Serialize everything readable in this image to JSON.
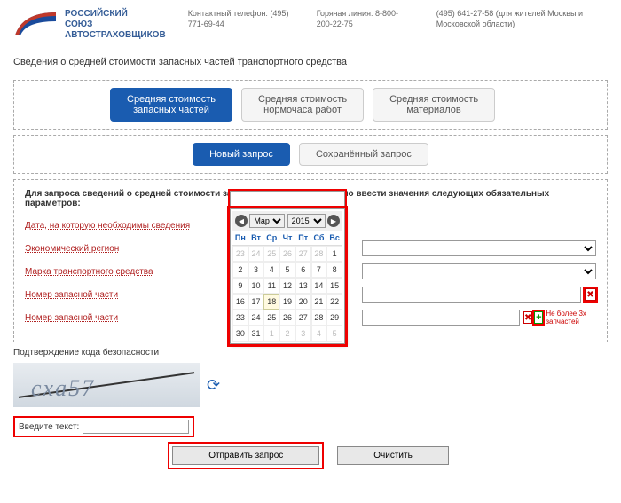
{
  "header": {
    "org_line1": "РОССИЙСКИЙ",
    "org_line2": "СОЮЗ",
    "org_line3": "АВТОСТРАХОВЩИКОВ",
    "contact1_label": "Контактный телефон: (495) 771-69-44",
    "contact2_label": "Горячая линия: 8-800-200-22-75",
    "contact3_label": "(495) 641-27-58 (для жителей Москвы и Московской области)"
  },
  "page_title": "Сведения о средней стоимости запасных частей транспортного средства",
  "tabs_main": {
    "parts": "Средняя стоимость\nзапасных частей",
    "hours": "Средняя стоимость\nнормочаса работ",
    "materials": "Средняя стоимость\nматериалов"
  },
  "tabs_query": {
    "new": "Новый запрос",
    "saved": "Сохранённый запрос"
  },
  "form": {
    "instruction": "Для запроса сведений о средней стоимости запасных частей необходимо ввести значения следующих обязательных параметров:",
    "date_label": "Дата, на которую необходимы сведения",
    "region_label": "Экономический регион",
    "brand_label": "Марка транспортного средства",
    "part1_label": "Номер запасной части",
    "part2_label": "Номер запасной части",
    "hint": "Не более 3х запчастей"
  },
  "calendar": {
    "month": "Мар",
    "year": "2015",
    "dow": [
      "Пн",
      "Вт",
      "Ср",
      "Чт",
      "Пт",
      "Сб",
      "Вс"
    ],
    "cells": [
      {
        "d": 23,
        "dim": true
      },
      {
        "d": 24,
        "dim": true
      },
      {
        "d": 25,
        "dim": true
      },
      {
        "d": 26,
        "dim": true
      },
      {
        "d": 27,
        "dim": true
      },
      {
        "d": 28,
        "dim": true
      },
      {
        "d": 1
      },
      {
        "d": 2
      },
      {
        "d": 3
      },
      {
        "d": 4
      },
      {
        "d": 5
      },
      {
        "d": 6
      },
      {
        "d": 7
      },
      {
        "d": 8
      },
      {
        "d": 9
      },
      {
        "d": 10
      },
      {
        "d": 11
      },
      {
        "d": 12
      },
      {
        "d": 13
      },
      {
        "d": 14
      },
      {
        "d": 15
      },
      {
        "d": 16
      },
      {
        "d": 17
      },
      {
        "d": 18,
        "today": true
      },
      {
        "d": 19
      },
      {
        "d": 20
      },
      {
        "d": 21
      },
      {
        "d": 22
      },
      {
        "d": 23
      },
      {
        "d": 24
      },
      {
        "d": 25
      },
      {
        "d": 26
      },
      {
        "d": 27
      },
      {
        "d": 28
      },
      {
        "d": 29
      },
      {
        "d": 30
      },
      {
        "d": 31
      },
      {
        "d": 1,
        "dim": true
      },
      {
        "d": 2,
        "dim": true
      },
      {
        "d": 3,
        "dim": true
      },
      {
        "d": 4,
        "dim": true
      },
      {
        "d": 5,
        "dim": true
      }
    ]
  },
  "captcha": {
    "title": "Подтверждение кода безопасности",
    "text": "cxa57",
    "input_label": "Введите текст:"
  },
  "buttons": {
    "submit": "Отправить запрос",
    "clear": "Очистить"
  }
}
